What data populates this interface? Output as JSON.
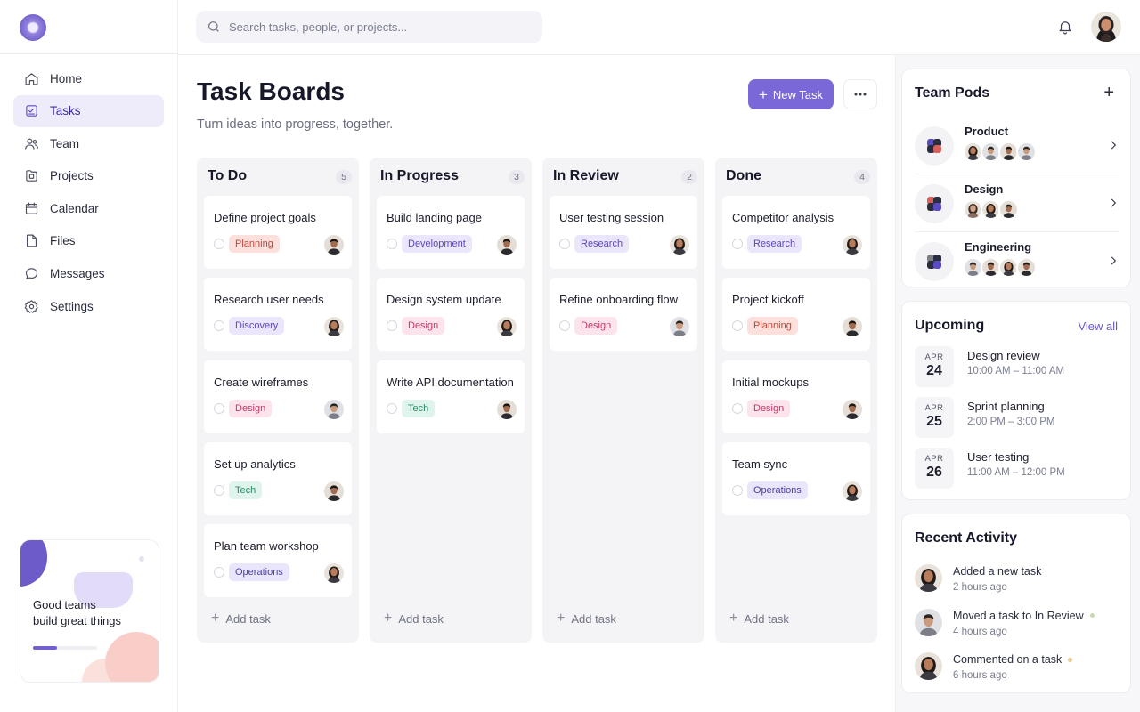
{
  "search": {
    "placeholder": "Search tasks, people, or projects..."
  },
  "nav": [
    {
      "label": "Home",
      "icon": "home-icon"
    },
    {
      "label": "Tasks",
      "icon": "tasks-icon",
      "active": true
    },
    {
      "label": "Team",
      "icon": "team-icon"
    },
    {
      "label": "Projects",
      "icon": "projects-icon"
    },
    {
      "label": "Calendar",
      "icon": "calendar-icon"
    },
    {
      "label": "Files",
      "icon": "file-icon"
    },
    {
      "label": "Messages",
      "icon": "message-icon"
    },
    {
      "label": "Settings",
      "icon": "gear-icon"
    }
  ],
  "promo": {
    "line1": "Good teams",
    "line2": "build great things",
    "progress": 0.37
  },
  "page": {
    "title": "Task Boards",
    "subtitle": "Turn ideas into progress, together.",
    "new_task_label": "New Task"
  },
  "columns": [
    {
      "title": "To Do",
      "count": "5",
      "add_label": "Add task",
      "cards": [
        {
          "title": "Define project goals",
          "tag": "Planning"
        },
        {
          "title": "Research user needs",
          "tag": "Discovery"
        },
        {
          "title": "Create wireframes",
          "tag": "Design"
        },
        {
          "title": "Set up analytics",
          "tag": "Tech"
        },
        {
          "title": "Plan team workshop",
          "tag": "Operations"
        }
      ]
    },
    {
      "title": "In Progress",
      "count": "3",
      "add_label": "Add task",
      "cards": [
        {
          "title": "Build landing page",
          "tag": "Development"
        },
        {
          "title": "Design system update",
          "tag": "Design"
        },
        {
          "title": "Write API documentation",
          "tag": "Tech"
        }
      ]
    },
    {
      "title": "In Review",
      "count": "2",
      "add_label": "Add task",
      "cards": [
        {
          "title": "User testing session",
          "tag": "Research"
        },
        {
          "title": "Refine onboarding flow",
          "tag": "Design"
        }
      ]
    },
    {
      "title": "Done",
      "count": "4",
      "add_label": "Add task",
      "cards": [
        {
          "title": "Competitor analysis",
          "tag": "Research"
        },
        {
          "title": "Project kickoff",
          "tag": "Planning"
        },
        {
          "title": "Initial mockups",
          "tag": "Design"
        },
        {
          "title": "Team sync",
          "tag": "Operations"
        }
      ]
    }
  ],
  "tag_colors": {
    "Planning": {
      "bg": "#fde0dc",
      "fg": "#c2463a"
    },
    "Discovery": {
      "bg": "#ebe6fb",
      "fg": "#5b49b8"
    },
    "Design": {
      "bg": "#fde3ec",
      "fg": "#c23a6a"
    },
    "Tech": {
      "bg": "#dff4ec",
      "fg": "#2b8a66"
    },
    "Operations": {
      "bg": "#e9e6fb",
      "fg": "#4b3fa8"
    },
    "Development": {
      "bg": "#ebe6fb",
      "fg": "#5b49b8"
    },
    "Research": {
      "bg": "#ebe6fb",
      "fg": "#5b49b8"
    }
  },
  "pods": {
    "title": "Team Pods",
    "items": [
      {
        "name": "Product"
      },
      {
        "name": "Design"
      },
      {
        "name": "Engineering"
      }
    ]
  },
  "upcoming": {
    "title": "Upcoming",
    "view_all": "View all",
    "events": [
      {
        "month": "APR",
        "day": "24",
        "title": "Design review",
        "time": "10:00 AM – 11:00 AM"
      },
      {
        "month": "APR",
        "day": "25",
        "title": "Sprint planning",
        "time": "2:00 PM – 3:00 PM"
      },
      {
        "month": "APR",
        "day": "26",
        "title": "User testing",
        "time": "11:00 AM – 12:00 PM"
      }
    ]
  },
  "activity": {
    "title": "Recent Activity",
    "items": [
      {
        "text": "Added a new task",
        "time": "2 hours ago"
      },
      {
        "text": "Moved a task to In Review",
        "time": "4 hours ago"
      },
      {
        "text": "Commented on a task",
        "time": "6 hours ago"
      }
    ]
  },
  "colors": {
    "accent": "#7a68d8",
    "active_nav_bg": "#eeecfb"
  }
}
